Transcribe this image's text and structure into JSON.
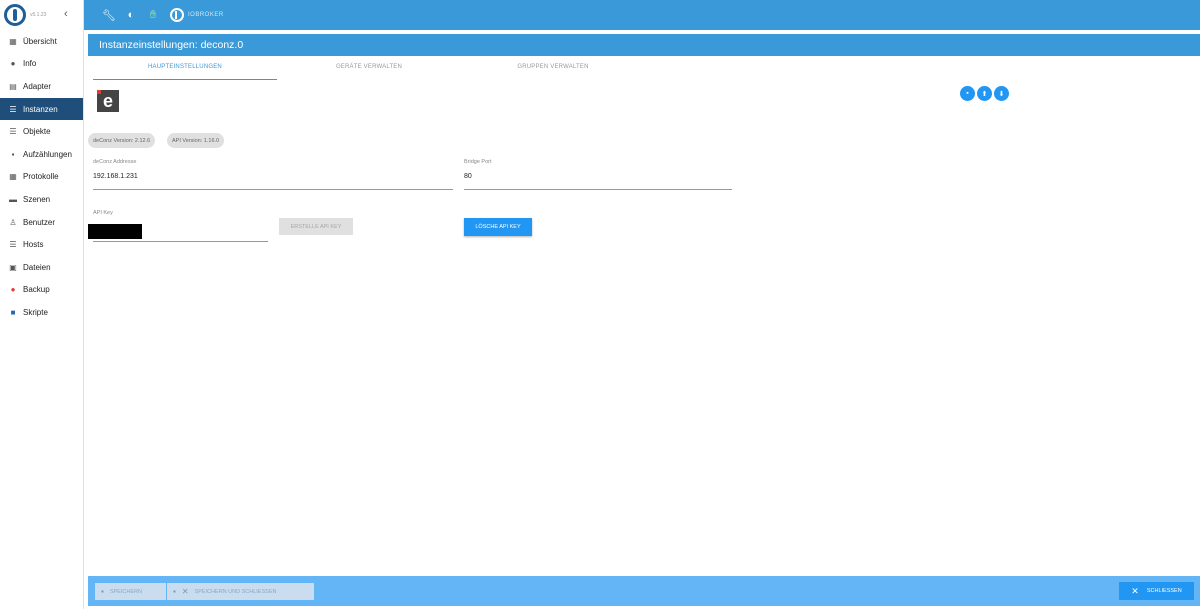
{
  "app": {
    "version": "v5.1.23",
    "brand": "IOBROKER"
  },
  "sidebar": {
    "items": [
      {
        "label": "Übersicht",
        "icon": "grid-icon"
      },
      {
        "label": "Info",
        "icon": "info-icon"
      },
      {
        "label": "Adapter",
        "icon": "store-icon"
      },
      {
        "label": "Instanzen",
        "icon": "list-icon",
        "active": true
      },
      {
        "label": "Objekte",
        "icon": "list-icon"
      },
      {
        "label": "Aufzählungen",
        "icon": "category-icon"
      },
      {
        "label": "Protokolle",
        "icon": "doc-icon"
      },
      {
        "label": "Szenen",
        "icon": "scene-icon"
      },
      {
        "label": "Benutzer",
        "icon": "user-icon"
      },
      {
        "label": "Hosts",
        "icon": "hosts-icon"
      },
      {
        "label": "Dateien",
        "icon": "files-icon"
      },
      {
        "label": "Backup",
        "icon": "backup-icon"
      },
      {
        "label": "Skripte",
        "icon": "scripts-icon"
      }
    ]
  },
  "title": "Instanzeinstellungen: deconz.0",
  "tabs": [
    "HAUPTEINSTELLUNGEN",
    "GERÄTE VERWALTEN",
    "GRUPPEN VERWALTEN"
  ],
  "chips": {
    "deconz_version": "deConz Version: 2.12.6",
    "api_version": "API Version: 1.16.0"
  },
  "fields": {
    "address_label": "deConz Addresse",
    "address_value": "192.168.1.231",
    "port_label": "Bridge Port",
    "port_value": "80",
    "apikey_label": "API Key"
  },
  "buttons": {
    "create_api_key": "ERSTELLE API KEY",
    "delete_api_key": "LÖSCHE API KEY",
    "save": "SPEICHERN",
    "save_close": "SPEICHERN UND SCHLIESSEN",
    "close": "SCHLIESSEN"
  },
  "colors": {
    "accent": "#3a99d8",
    "primary_button": "#2196f3",
    "active_nav": "#1f4e7a"
  }
}
